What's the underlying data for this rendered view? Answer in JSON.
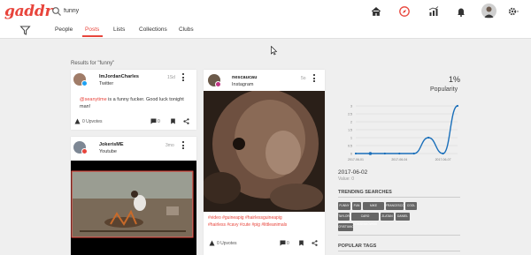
{
  "brand": {
    "logo": "gaddr",
    "accent_color": "#e8453c"
  },
  "search": {
    "value": "funny"
  },
  "topnav": {
    "icons": [
      "home-icon",
      "compass-icon",
      "stats-icon",
      "bell-icon",
      "avatar",
      "gear-icon"
    ]
  },
  "tabs": [
    {
      "label": "People"
    },
    {
      "label": "Posts",
      "active": true
    },
    {
      "label": "Lists"
    },
    {
      "label": "Collections"
    },
    {
      "label": "Clubs"
    }
  ],
  "results_label": "Results for \"funny\"",
  "cards": [
    {
      "username": "ImJordanCharles",
      "platform": "Twitter",
      "time": "1Sd",
      "text_mention": "@seanytime",
      "text_body": " is a funny fucker. Good luck tonight man!",
      "upvotes": "0 Upvotes",
      "comments": "0"
    },
    {
      "username": "JokerisME",
      "platform": "Youtube",
      "time": "3mo"
    },
    {
      "username": "nescaucau",
      "platform": "Instagram",
      "time": "5o",
      "hashtags_line1": "#video #guineapig #hairlessguineapig",
      "hashtags_line2": "#hairless #cavy #cute #pig #littleanimals",
      "upvotes": "0 Upvotes",
      "comments": "0"
    }
  ],
  "popularity": {
    "percent": "1%",
    "label": "Popularity",
    "selected_date": "2017-06-02",
    "selected_value": "Value: 0"
  },
  "chart_data": {
    "type": "line",
    "x": [
      "2017-06-01",
      "2017-06-02",
      "2017-06-03",
      "2017-06-04",
      "2017-06-05",
      "2017-06-06",
      "2017-06-07",
      "2017-06-08"
    ],
    "xticks": [
      "2017-06-01",
      "2017-06-04",
      "2017-06-07"
    ],
    "values": [
      0,
      0,
      0,
      0,
      0,
      1,
      0,
      3
    ],
    "ylim": [
      0,
      3
    ],
    "yticks": [
      "0",
      "0.5",
      "1",
      "1.5",
      "2",
      "2.5",
      "3"
    ],
    "line_color": "#1a6fba",
    "grid": true
  },
  "trending": {
    "title": "TRENDING SEARCHES",
    "chips": [
      "FUNNY",
      "FUN",
      "MIKE SHEZOME",
      "FRANCESCO",
      "COOL",
      "TAYLOR",
      "CARO KOMZENKOWSKI",
      "ZLATAN",
      "DANIEL",
      "CRISTIANO"
    ]
  },
  "popular_tags": {
    "title": "POPULAR TAGS"
  }
}
